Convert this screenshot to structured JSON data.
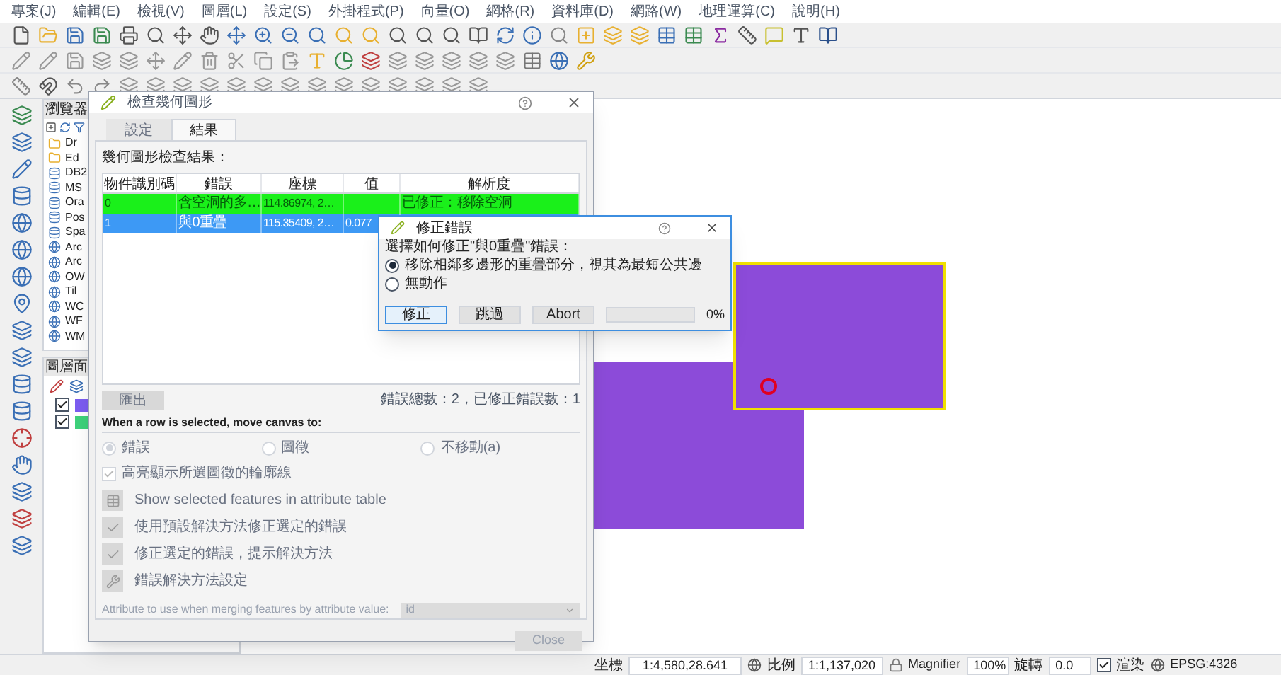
{
  "menu": [
    "專案(J)",
    "編輯(E)",
    "檢視(V)",
    "圖層(L)",
    "設定(S)",
    "外掛程式(P)",
    "向量(O)",
    "網格(R)",
    "資料庫(D)",
    "網路(W)",
    "地理運算(C)",
    "說明(H)"
  ],
  "browser_panel": {
    "title": "瀏覽器",
    "items": [
      {
        "label": "Dr",
        "kind": "folder"
      },
      {
        "label": "Ed",
        "kind": "folder"
      },
      {
        "label": "DB2",
        "kind": "db"
      },
      {
        "label": "MS",
        "kind": "db"
      },
      {
        "label": "Ora",
        "kind": "db"
      },
      {
        "label": "Pos",
        "kind": "db"
      },
      {
        "label": "Spa",
        "kind": "db"
      },
      {
        "label": "Arc",
        "kind": "globe"
      },
      {
        "label": "Arc",
        "kind": "globe"
      },
      {
        "label": "OW",
        "kind": "globe"
      },
      {
        "label": "Til",
        "kind": "globe"
      },
      {
        "label": "WC",
        "kind": "globe"
      },
      {
        "label": "WF",
        "kind": "globe"
      },
      {
        "label": "WM",
        "kind": "globe"
      }
    ]
  },
  "layers_panel": {
    "title": "圖層面",
    "layers": [
      {
        "checked": true,
        "color": "#7b5cf0"
      },
      {
        "checked": true,
        "color": "#3ed17a"
      }
    ]
  },
  "check_dialog": {
    "title": "檢查幾何圖形",
    "tabs": [
      {
        "label": "設定",
        "selected": false
      },
      {
        "label": "結果",
        "selected": true
      }
    ],
    "results_label": "幾何圖形檢查結果：",
    "columns": [
      "物件識別碼",
      "錯誤",
      "座標",
      "值",
      "解析度"
    ],
    "rows": [
      {
        "cells": [
          "0",
          "含空洞的多…",
          "114.86974, 2…",
          "",
          "已修正：移除空洞"
        ],
        "fixed": true,
        "selected": false
      },
      {
        "cells": [
          "1",
          "與0重疊",
          "115.35409, 2…",
          "0.077",
          ""
        ],
        "fixed": false,
        "selected": true
      }
    ],
    "export_button": "匯出",
    "summary": "錯誤總數：2，已修正錯誤數：1",
    "move_label": "When a row is selected, move canvas to:",
    "move_options": [
      {
        "label": "錯誤",
        "selected": true
      },
      {
        "label": "圖徵",
        "selected": false
      },
      {
        "label": "不移動(a)",
        "selected": false
      }
    ],
    "move_disabled": true,
    "highlight": {
      "label": "高亮顯示所選圖徵的輪廓線",
      "checked": true,
      "disabled": true
    },
    "actions": [
      {
        "label": "Show selected features in attribute table",
        "kind": "table"
      },
      {
        "label": "使用預設解決方法修正選定的錯誤",
        "kind": "check"
      },
      {
        "label": "修正選定的錯誤，提示解決方法",
        "kind": "check"
      },
      {
        "label": "錯誤解決方法設定",
        "kind": "tool"
      }
    ],
    "merge_label": "Attribute to use when merging features by attribute value:",
    "merge_value": "id",
    "close_button": "Close"
  },
  "fix_dialog": {
    "title": "修正錯誤",
    "prompt": "選擇如何修正\"與0重疊\"錯誤：",
    "options": [
      {
        "label": "移除相鄰多邊形的重疊部分，視其為最短公共邊",
        "selected": true
      },
      {
        "label": "無動作",
        "selected": false
      }
    ],
    "buttons": [
      "修正",
      "跳過",
      "Abort"
    ],
    "progress": {
      "level": 0
    },
    "progress_text": "0%"
  },
  "status_bar": {
    "coordinate_label": "坐標",
    "coordinate": "1:4,580,28.641",
    "scale_label": "比例",
    "scale": "1:1,137,020",
    "magnifier_label": "Magnifier",
    "magnifier": "100%",
    "rotation_label": "旋轉",
    "rotation": "0.0",
    "render": {
      "label": "渲染",
      "checked": true
    },
    "crs": "EPSG:4326"
  }
}
